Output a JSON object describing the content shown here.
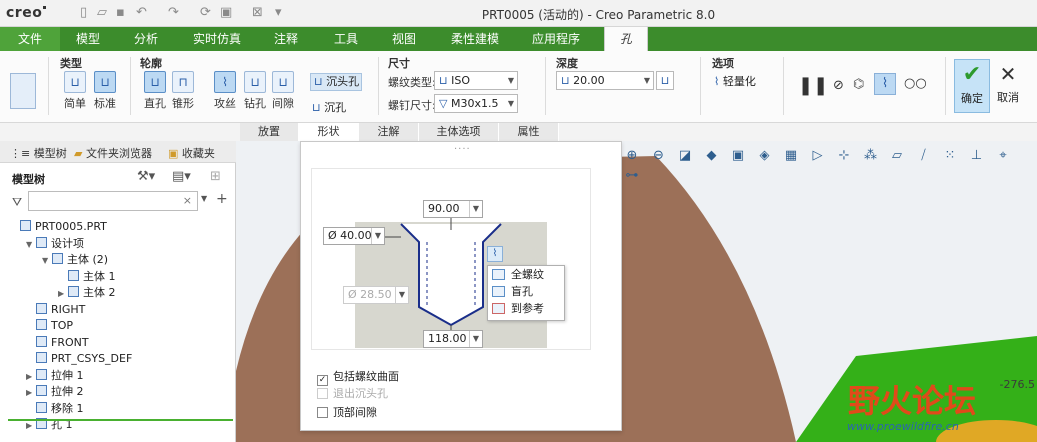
{
  "app": {
    "logo": "creo",
    "window_title": "PRT0005 (活动的) - Creo Parametric 8.0"
  },
  "ribbon_tabs": [
    "文件",
    "模型",
    "分析",
    "实时仿真",
    "注释",
    "工具",
    "视图",
    "柔性建模",
    "应用程序",
    "孔"
  ],
  "ribbon": {
    "type_group": {
      "title": "类型",
      "simple": "简单",
      "standard": "标准"
    },
    "profile_group": {
      "title": "轮廓",
      "straight": "直孔",
      "taper": "锥形"
    },
    "thread_group": {
      "tap": "攻丝",
      "drill": "钻孔",
      "clearance": "间隙"
    },
    "countersink": "沉头孔",
    "counterbore": "沉孔",
    "dimension_group": {
      "title": "尺寸",
      "screw_type_label": "螺纹类型:",
      "screw_type_value": "ISO",
      "screw_size_label": "螺钉尺寸:",
      "screw_size_value": "M30x1.5"
    },
    "depth_group": {
      "title": "深度",
      "depth_value": "20.00"
    },
    "options_group": {
      "title": "选项",
      "lightweight": "轻量化"
    },
    "ok": "确定",
    "cancel": "取消"
  },
  "sub_tabs": [
    "放置",
    "形状",
    "注解",
    "主体选项",
    "属性"
  ],
  "left_panel": {
    "tabs": [
      "模型树",
      "文件夹浏览器",
      "收藏夹"
    ],
    "tree_title": "模型树",
    "tree": [
      {
        "label": "PRT0005.PRT",
        "indent": 0,
        "arrow": ""
      },
      {
        "label": "设计项",
        "indent": 1,
        "arrow": "▼"
      },
      {
        "label": "主体 (2)",
        "indent": 2,
        "arrow": "▼"
      },
      {
        "label": "主体 1",
        "indent": 3,
        "arrow": ""
      },
      {
        "label": "主体 2",
        "indent": 3,
        "arrow": "▶"
      },
      {
        "label": "RIGHT",
        "indent": 1,
        "arrow": ""
      },
      {
        "label": "TOP",
        "indent": 1,
        "arrow": ""
      },
      {
        "label": "FRONT",
        "indent": 1,
        "arrow": ""
      },
      {
        "label": "PRT_CSYS_DEF",
        "indent": 1,
        "arrow": ""
      },
      {
        "label": "拉伸 1",
        "indent": 1,
        "arrow": "▶"
      },
      {
        "label": "拉伸 2",
        "indent": 1,
        "arrow": "▶"
      },
      {
        "label": "移除 1",
        "indent": 1,
        "arrow": ""
      },
      {
        "label": "孔 1",
        "indent": 1,
        "arrow": "▶"
      }
    ]
  },
  "shape_panel": {
    "angle": "90.00",
    "countersink_dia": "Ø 40.00",
    "hole_dia": "Ø 28.50",
    "depth": "118.00",
    "popup": [
      "全螺纹",
      "盲孔",
      "到参考"
    ],
    "include_thread_surface": "包括螺纹曲面",
    "exit_countersink": "退出沉头孔",
    "top_clearance": "顶部间隙"
  },
  "view_readout": "-276.5",
  "watermark": {
    "text": "野火论坛",
    "url": "www.proewildfire.cn"
  },
  "colors": {
    "ribbon_green": "#3c8c2c",
    "file_tab": "#4fa33a",
    "model_brown": "#9c7058",
    "model_green": "#34b018"
  }
}
